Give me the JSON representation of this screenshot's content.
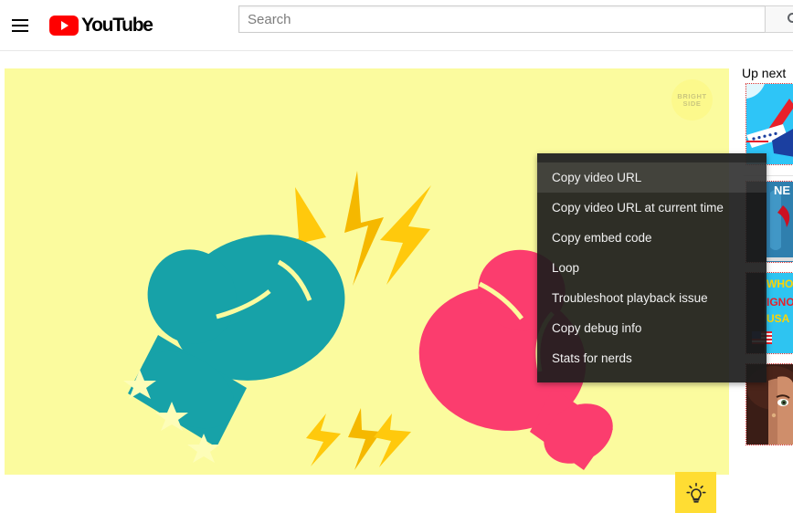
{
  "masthead": {
    "guide_icon": "hamburger-menu-icon",
    "logo_text": "YouTube",
    "logo_icon": "youtube-play-icon",
    "search": {
      "placeholder": "Search",
      "value": "",
      "button_icon": "search-icon"
    }
  },
  "player": {
    "background_color": "#fbfb9e",
    "watermark": {
      "line1": "BRIGHT",
      "line2": "SIDE"
    },
    "lightbulb_button": {
      "icon": "lightbulb-icon",
      "background_color": "#ffdd33"
    },
    "artwork": {
      "left_glove_color": "#17a2a8",
      "right_glove_color": "#fb3d6e",
      "bolt_color": "#ffc107",
      "star_color": "#fdfdb8"
    }
  },
  "context_menu": {
    "items": [
      {
        "label": "Copy video URL",
        "hovered": true
      },
      {
        "label": "Copy video URL at current time",
        "hovered": false
      },
      {
        "label": "Copy embed code",
        "hovered": false
      },
      {
        "label": "Loop",
        "hovered": false
      },
      {
        "label": "Troubleshoot playback issue",
        "hovered": false
      },
      {
        "label": "Copy debug info",
        "hovered": false
      },
      {
        "label": "Stats for nerds",
        "hovered": false
      }
    ]
  },
  "sidebar": {
    "title": "Up next",
    "related": [
      {
        "name": "airplane-thumbnail",
        "colors": [
          "#29c5f6",
          "#ffffff",
          "#e8202a",
          "#1b3fa0"
        ]
      },
      {
        "name": "news-bottle-thumbnail",
        "colors": [
          "#123043",
          "#2a7fb0",
          "#ffffff",
          "#cc1122"
        ]
      },
      {
        "name": "who-ignores-usa-thumbnail",
        "colors": [
          "#2ec4f1",
          "#ffd400",
          "#e8202a",
          "#1b3fa0"
        ]
      },
      {
        "name": "portrait-face-thumbnail",
        "colors": [
          "#3a1d16",
          "#7c4533",
          "#c98a63"
        ]
      }
    ]
  }
}
